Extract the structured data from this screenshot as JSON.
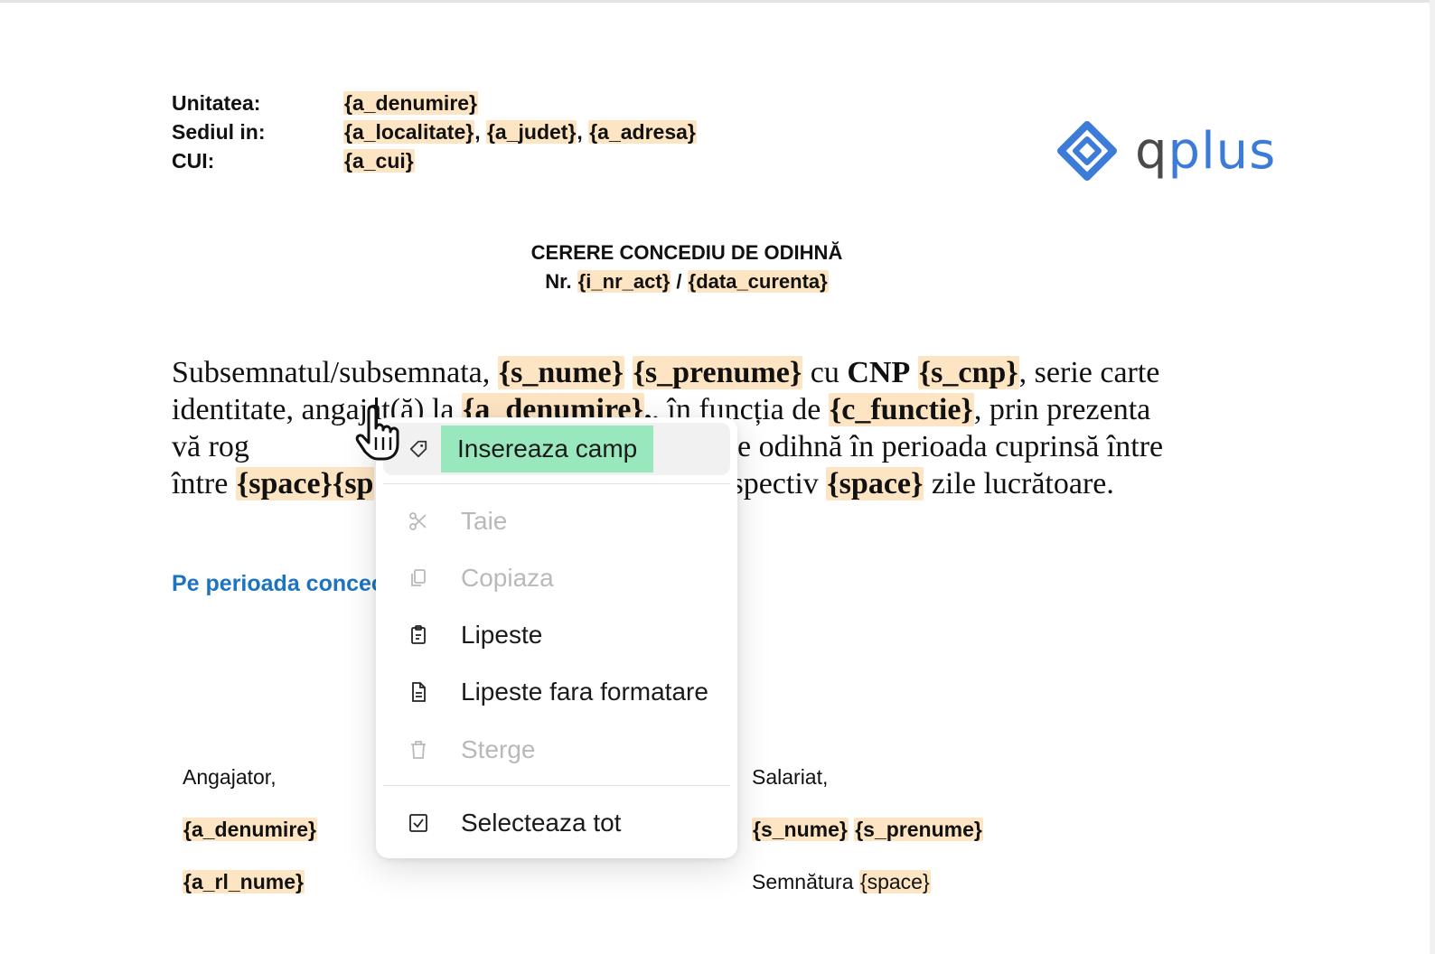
{
  "header": {
    "labels": [
      "Unitatea:",
      "Sediul in:",
      "CUI:"
    ],
    "unitatea": "{a_denumire}",
    "sediul": [
      "{a_localitate}",
      "{a_judet}",
      "{a_adresa}"
    ],
    "cui": "{a_cui}"
  },
  "logo": {
    "text_q": "q",
    "text_plus": "plus",
    "icon": "diamond-logo-icon"
  },
  "title": {
    "line1": "CERERE CONCEDIU DE ODIHNĂ",
    "nr_label": "Nr.",
    "nr_field": "{i_nr_act}",
    "separator": "/",
    "date_field": "{data_curenta}"
  },
  "body": {
    "t1": "Subsemnatul/subsemnata, ",
    "f_nume": "{s_nume}",
    "f_prenume": "{s_prenume}",
    "t2": " cu ",
    "cnp": "CNP",
    "f_cnp": "{s_cnp}",
    "t3": ", serie carte identitate, angajat(ă) la ",
    "f_denumire": "{a_denumire}",
    "t4": ", în funcția de ",
    "f_functie": "{c_functie}",
    "t5": ", prin prezenta vă rog",
    "t6": "e odihnă în perioada cuprinsă între ",
    "f_space1": "{space}{sp",
    "t7": "spectiv ",
    "f_space2": "{space}",
    "t8": "  zile lucrătoare."
  },
  "blue_text": "Pe perioada concec",
  "signatures": {
    "left_label": "Angajator,",
    "left_f1": "{a_denumire}",
    "left_f2": "{a_rl_nume}",
    "right_label": "Salariat,",
    "right_f1": "{s_nume}",
    "right_f2": "{s_prenume}",
    "right_sig_label": "Semnătura",
    "right_sig_field": "{space}"
  },
  "context_menu": {
    "items": [
      {
        "label": "Insereaza camp",
        "icon": "tag-icon",
        "enabled": true,
        "highlighted": true
      },
      {
        "label": "Taie",
        "icon": "scissors-icon",
        "enabled": false
      },
      {
        "label": "Copiaza",
        "icon": "copy-icon",
        "enabled": false
      },
      {
        "label": "Lipeste",
        "icon": "clipboard-icon",
        "enabled": true
      },
      {
        "label": "Lipeste fara formatare",
        "icon": "file-text-icon",
        "enabled": true
      },
      {
        "label": "Sterge",
        "icon": "trash-icon",
        "enabled": false
      },
      {
        "label": "Selecteaza tot",
        "icon": "checkbox-icon",
        "enabled": true
      }
    ]
  },
  "colors": {
    "field_highlight": "#fde5c3",
    "menu_highlight": "#98e7bd",
    "link_blue": "#1b73c1",
    "logo_blue": "#3d7bd9"
  }
}
